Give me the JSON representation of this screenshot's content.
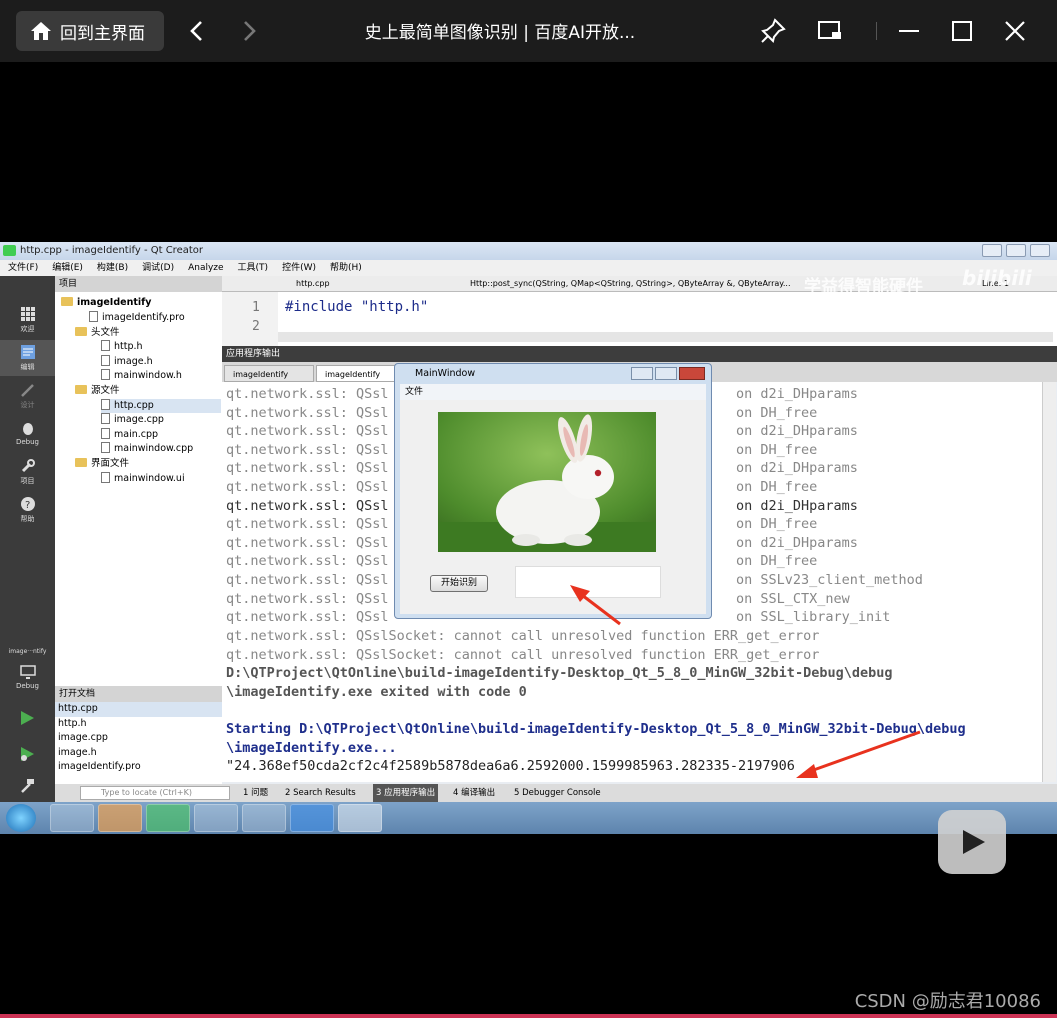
{
  "player": {
    "home_label": "回到主界面",
    "title": "史上最简单图像识别 | 百度AI开放..."
  },
  "qt": {
    "window_title": "http.cpp - imageIdentify - Qt Creator",
    "menu": [
      "文件(F)",
      "编辑(E)",
      "构建(B)",
      "调试(D)",
      "Analyze",
      "工具(T)",
      "控件(W)",
      "帮助(H)"
    ],
    "modes": [
      "欢迎",
      "编辑",
      "设计",
      "Debug",
      "项目",
      "帮助"
    ],
    "kit_label": "image···ntify",
    "kit_mode": "Debug",
    "project_panel_label": "项目",
    "tree": {
      "root": "imageIdentify",
      "pro": "imageIdentify.pro",
      "headers_folder": "头文件",
      "headers": [
        "http.h",
        "image.h",
        "mainwindow.h"
      ],
      "sources_folder": "源文件",
      "sources": [
        "http.cpp",
        "image.cpp",
        "main.cpp",
        "mainwindow.cpp"
      ],
      "forms_folder": "界面文件",
      "forms": [
        "mainwindow.ui"
      ]
    },
    "open_docs_label": "打开文档",
    "open_docs": [
      "http.cpp",
      "http.h",
      "image.cpp",
      "image.h",
      "imageIdentify.pro"
    ],
    "editor_tab": "http.cpp",
    "editor_func": "Http::post_sync(QString, QMap<QString, QString>, QByteArray &, QByteArray...",
    "editor_line_info": "Line: 1",
    "code_line_numbers": [
      "1",
      "2"
    ],
    "code_line1": "#include \"http.h\"",
    "output_panel_label": "应用程序输出",
    "output_tabs": [
      "imageIdentify",
      "imageIdentify"
    ],
    "output_lines_left": [
      "qt.network.ssl: QSsl",
      "qt.network.ssl: QSsl",
      "qt.network.ssl: QSsl",
      "qt.network.ssl: QSsl",
      "qt.network.ssl: QSsl",
      "qt.network.ssl: QSsl",
      "qt.network.ssl: QSsl",
      "qt.network.ssl: QSsl",
      "qt.network.ssl: QSsl",
      "qt.network.ssl: QSsl",
      "qt.network.ssl: QSsl",
      "qt.network.ssl: QSsl",
      "qt.network.ssl: QSsl"
    ],
    "output_lines_right": [
      "on d2i_DHparams",
      "on DH_free",
      "on d2i_DHparams",
      "on DH_free",
      "on d2i_DHparams",
      "on DH_free",
      "on d2i_DHparams",
      "on DH_free",
      "on d2i_DHparams",
      "on DH_free",
      "on SSLv23_client_method",
      "on SSL_CTX_new",
      "on SSL_library_init"
    ],
    "output_full_lines": [
      "qt.network.ssl: QSslSocket: cannot call unresolved function ERR_get_error",
      "qt.network.ssl: QSslSocket: cannot call unresolved function ERR_get_error"
    ],
    "exit_line1": "D:\\QTProject\\QtOnline\\build-imageIdentify-Desktop_Qt_5_8_0_MinGW_32bit-Debug\\debug",
    "exit_line2": "\\imageIdentify.exe exited with code 0",
    "start_line1": "Starting D:\\QTProject\\QtOnline\\build-imageIdentify-Desktop_Qt_5_8_0_MinGW_32bit-Debug\\debug",
    "start_line2": "\\imageIdentify.exe...",
    "token_line": "\"24.368ef50cda2cf2c4f2589b5878dea6a6.2592000.1599985963.282335-2197906",
    "locate_placeholder": "Type to locate (Ctrl+K)",
    "status_tabs": [
      "1 问题",
      "2 Search Results",
      "3 应用程序输出",
      "4 编译输出",
      "5 Debugger Console"
    ],
    "watermark_brand": "学益得智能硬件",
    "watermark_site": "bilibili"
  },
  "mainwindow": {
    "title": "MainWindow",
    "menu": "文件",
    "button": "开始识别",
    "result": ""
  },
  "footer": {
    "csdn": "CSDN @励志君10086"
  },
  "colors": {
    "accent_arrow": "#e8321e",
    "output_blue": "#1f2f8c"
  }
}
